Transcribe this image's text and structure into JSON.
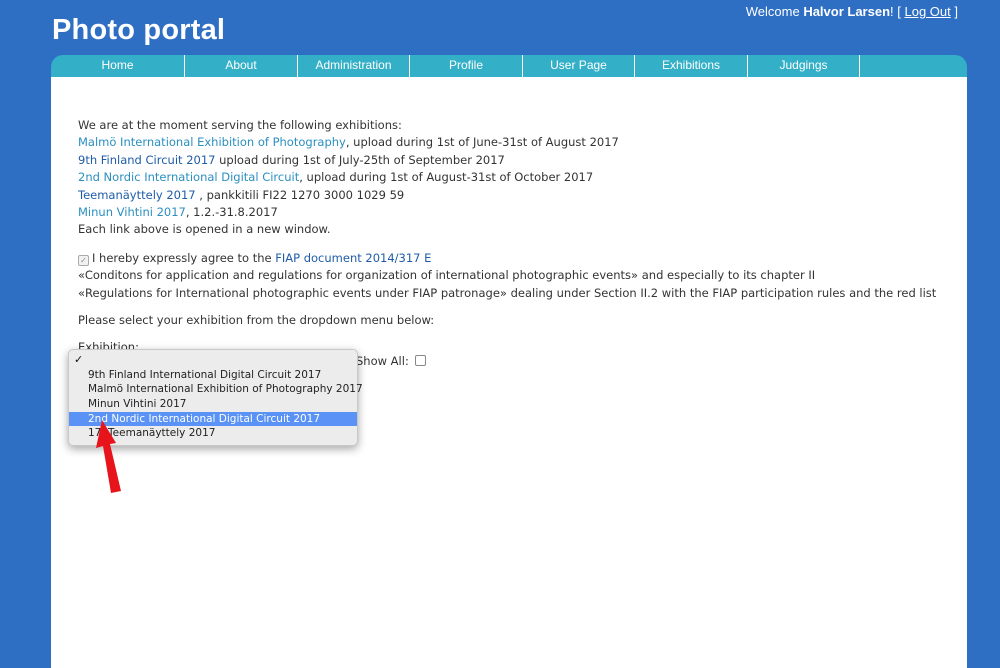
{
  "header": {
    "title": "Photo portal",
    "welcome_prefix": "Welcome",
    "user_name": "Halvor Larsen",
    "welcome_mid": "! [",
    "logout_label": "Log Out",
    "welcome_suffix": "]"
  },
  "nav": {
    "items": [
      {
        "label": "Home"
      },
      {
        "label": "About"
      },
      {
        "label": "Administration"
      },
      {
        "label": "Profile"
      },
      {
        "label": "User Page"
      },
      {
        "label": "Exhibitions"
      },
      {
        "label": "Judgings"
      }
    ]
  },
  "main": {
    "intro": "We are at the moment serving the following exhibitions:",
    "exhibitions": [
      {
        "link": "Malmö International Exhibition of Photography",
        "detail": ", upload during 1st of June-31st of August 2017"
      },
      {
        "link": "9th Finland Circuit 2017",
        "detail": " upload during 1st of July-25th of September 2017"
      },
      {
        "link": "2nd Nordic International Digital Circuit",
        "detail": ", upload during 1st of August-31st of October 2017"
      },
      {
        "link": "Teemanäyttely 2017",
        "detail": " , pankkitili FI22 1270 3000 1029 59"
      },
      {
        "link": "Minun Vihtini 2017",
        "detail": ", 1.2.-31.8.2017"
      }
    ],
    "new_window_note": "Each link above is opened in a new window.",
    "agree_text": "I hereby expressly agree to the",
    "fiap_link": "FIAP document 2014/317 E",
    "conditions_line": "«Conditons for application and regulations for organization of international photographic events» and especially to its chapter II",
    "regulations_line": "«Regulations for International photographic events under FIAP patronage» dealing under Section II.2 with the FIAP participation rules and the red list",
    "select_prompt": "Please select your exhibition from the dropdown menu below:",
    "exhibition_label": "Exhibition:",
    "show_all_label": "Show All:"
  },
  "dropdown": {
    "check_mark": "✓",
    "options": [
      {
        "label": ""
      },
      {
        "label": "9th Finland International Digital Circuit 2017"
      },
      {
        "label": "Malmö International Exhibition of Photography 2017"
      },
      {
        "label": "Minun Vihtini 2017"
      },
      {
        "label": "2nd Nordic International Digital Circuit 2017"
      },
      {
        "label": "17. Teemanäyttely 2017"
      }
    ],
    "highlighted_index": 4
  },
  "colors": {
    "background": "#2e6fc4",
    "nav": "#33b0c7",
    "link": "#2b8fc0",
    "highlight": "#5a93f5",
    "arrow": "#e8141b"
  }
}
